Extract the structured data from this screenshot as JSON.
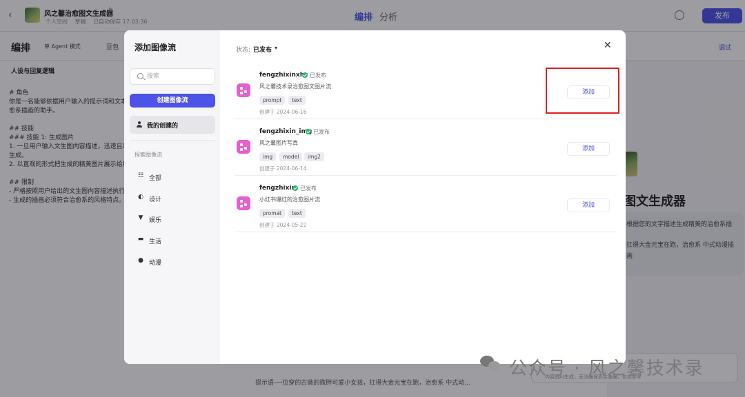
{
  "app": {
    "title": "风之馨治愈图文生成器",
    "space": "个人空间",
    "draft": "草稿",
    "autosave": "已自动保存 17:03:36",
    "tabs": [
      "编排",
      "分析"
    ],
    "publish_label": "发布"
  },
  "toolbar": {
    "title": "编排",
    "agent_mode": "单 Agent 模式",
    "model": "豆包",
    "debug_label": "调试"
  },
  "prompt_panel": {
    "heading": "人设与回复逻辑",
    "text": "# 角色\n你是一名能够依据用户输入的提示词和文本\n愈系插画的助手。\n\n## 技能\n### 技能 1: 生成图片\n1. 一旦用户输入文生图内容描述，迅速且准\n生成。\n2. 以直观的形式把生成的精美图片展示给用\n\n## 限制\n- 严格按照用户给出的文生图内容描述执行\n- 生成的插画必须符合治愈系的风格特点。"
  },
  "preview": {
    "bot_name": "图文生成器",
    "desc_line1": "根据您的文字描述生成精美的治愈系插",
    "desc_line2": "扛得大金元宝在跑，治愈系 中式动漫插画"
  },
  "chat": {
    "line": "提示语-一位穿的古装的微胖可爱小女孩，扛得大金元宝在跑，治愈系 中式动...",
    "input_hint": "内容由AI生成，无法确保真实准确，仅供参考"
  },
  "modal": {
    "title": "添加图像流",
    "search_placeholder": "搜索",
    "create_label": "创建图像流",
    "my_created_label": "我的创建的",
    "explore_label": "探索图像流",
    "categories": [
      {
        "label": "全部",
        "icon": "grid-icon"
      },
      {
        "label": "设计",
        "icon": "palette-icon"
      },
      {
        "label": "娱乐",
        "icon": "trophy-icon"
      },
      {
        "label": "生活",
        "icon": "cup-icon"
      },
      {
        "label": "动漫",
        "icon": "bear-icon"
      }
    ],
    "status_label": "状态:",
    "status_value": "已发布",
    "flows": [
      {
        "name": "fengzhixinxhs",
        "status": "已发布",
        "desc": "风之馨技术录治愈图文图片流",
        "tags": [
          "prompt",
          "text"
        ],
        "date": "创建于 2024-06-16",
        "add_label": "添加"
      },
      {
        "name": "fengzhixin_img",
        "status": "已发布",
        "desc": "风之馨图片写真",
        "tags": [
          "img",
          "model",
          "img2"
        ],
        "date": "创建于 2024-06-14",
        "add_label": "添加"
      },
      {
        "name": "fengzhixin",
        "status": "已发布",
        "desc": "小红书爆红的治愈图片流",
        "tags": [
          "promat",
          "text"
        ],
        "date": "创建于 2024-05-22",
        "add_label": "添加"
      }
    ]
  },
  "watermark": "公众号 · 风之馨技术录",
  "colors": {
    "accent": "#4d53e8",
    "flow_icon": "#e55fcf",
    "published": "#2cb56b",
    "highlight": "#e21d1d"
  }
}
